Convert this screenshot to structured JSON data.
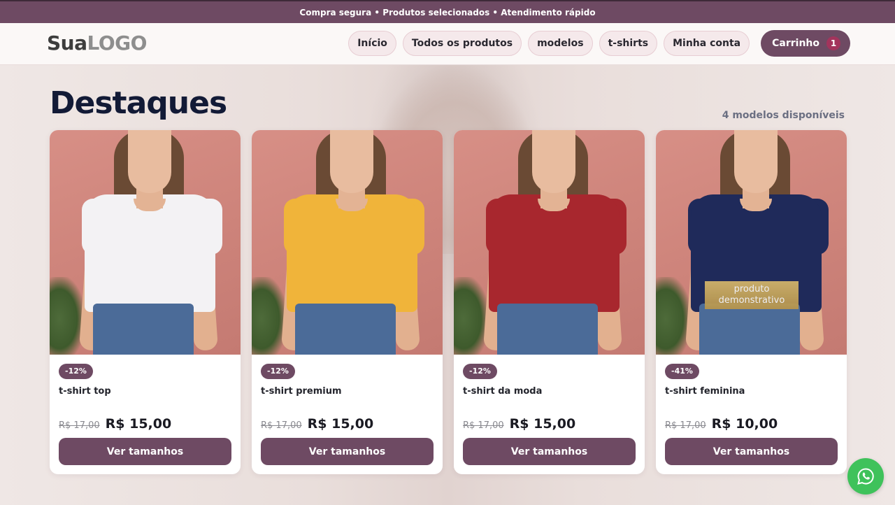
{
  "topbar": {
    "text": "Compra segura • Produtos selecionados • Atendimento rápido"
  },
  "header": {
    "logo": {
      "part1": "Sua",
      "part2": "LOGO"
    },
    "nav": [
      {
        "label": "Início"
      },
      {
        "label": "Todos os produtos"
      },
      {
        "label": "modelos"
      },
      {
        "label": "t-shirts"
      },
      {
        "label": "Minha conta"
      }
    ],
    "cart": {
      "label": "Carrinho",
      "count": "1"
    }
  },
  "section": {
    "title": "Destaques",
    "count_text": "4 modelos disponíveis"
  },
  "products": [
    {
      "discount": "-12%",
      "name": "t-shirt top",
      "old_price": "R$ 17,00",
      "price": "R$ 15,00",
      "button": "Ver tamanhos",
      "shirt_color": "#f3f2f4"
    },
    {
      "discount": "-12%",
      "name": "t-shirt premium",
      "old_price": "R$ 17,00",
      "price": "R$ 15,00",
      "button": "Ver tamanhos",
      "shirt_color": "#f0b43a"
    },
    {
      "discount": "-12%",
      "name": "t-shirt da moda",
      "old_price": "R$ 17,00",
      "price": "R$ 15,00",
      "button": "Ver tamanhos",
      "shirt_color": "#a8272e"
    },
    {
      "discount": "-41%",
      "name": "t-shirt feminina",
      "old_price": "R$ 17,00",
      "price": "R$ 10,00",
      "button": "Ver tamanhos",
      "shirt_color": "#1f2a5a",
      "tag_line1": "produto",
      "tag_line2": "demonstrativo"
    }
  ],
  "whatsapp": {
    "icon": "whatsapp-icon"
  }
}
